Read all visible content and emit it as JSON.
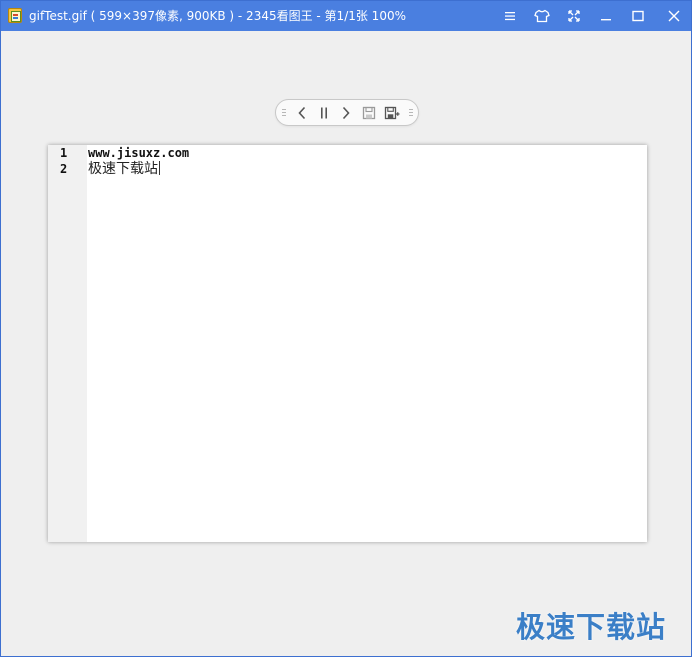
{
  "window": {
    "title": "gifTest.gif ( 599×397像素, 900KB ) - 2345看图王 - 第1/1张 100%"
  },
  "title_controls": [
    {
      "name": "menu",
      "icon": "menu-icon"
    },
    {
      "name": "skin",
      "icon": "tshirt-icon"
    },
    {
      "name": "fullscreen",
      "icon": "fullscreen-icon"
    },
    {
      "name": "minimize",
      "icon": "minimize-icon"
    },
    {
      "name": "maximize",
      "icon": "maximize-icon"
    },
    {
      "name": "close",
      "icon": "close-icon"
    }
  ],
  "toolbar": {
    "buttons": [
      {
        "name": "previous",
        "icon": "chevron-left-icon"
      },
      {
        "name": "pause",
        "icon": "pause-icon"
      },
      {
        "name": "next",
        "icon": "chevron-right-icon"
      },
      {
        "name": "save-frame",
        "icon": "save-icon"
      },
      {
        "name": "save-all-frames",
        "icon": "save-all-icon"
      }
    ]
  },
  "image": {
    "line_numbers": [
      "1",
      "2"
    ],
    "lines": [
      "www.jisuxz.com",
      "极速下载站"
    ]
  },
  "watermark": "极速下载站",
  "colors": {
    "titlebar": "#4a7fe0",
    "background": "#efefef",
    "watermark": "#3b7fc7"
  }
}
